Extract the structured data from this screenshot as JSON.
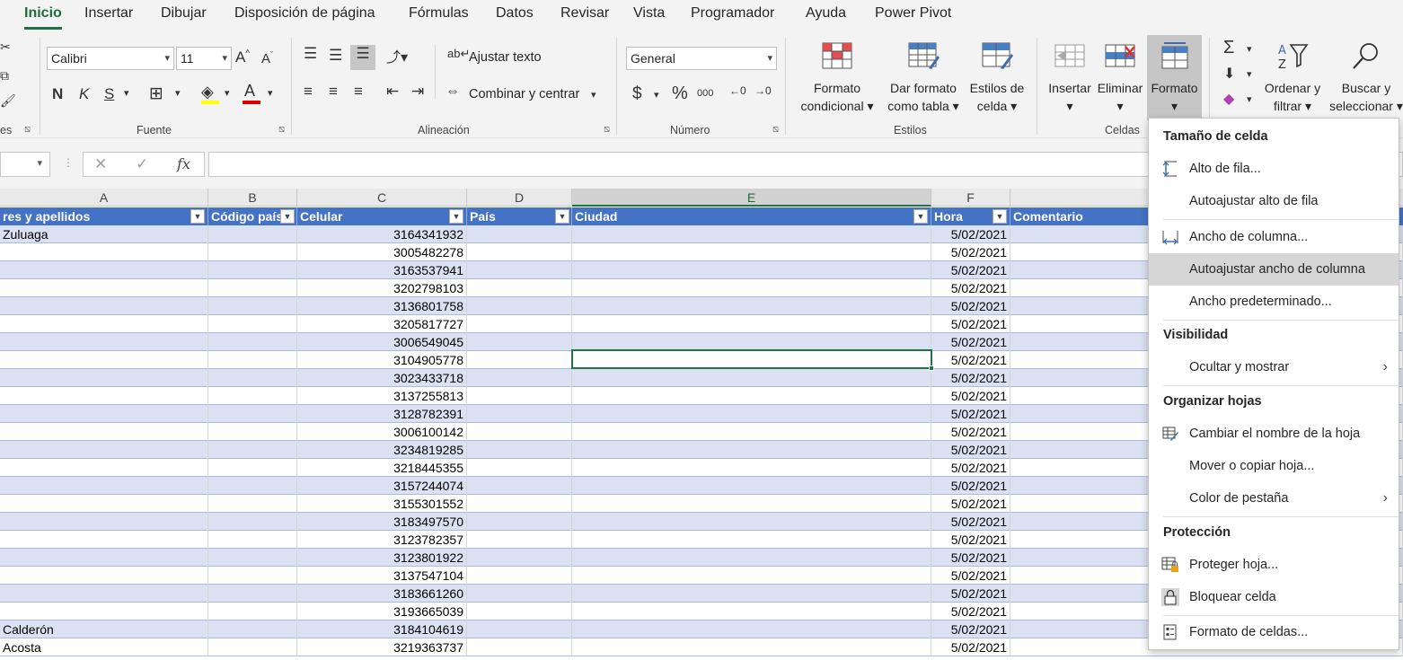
{
  "tabs": [
    "Inicio",
    "Insertar",
    "Dibujar",
    "Disposición de página",
    "Fórmulas",
    "Datos",
    "Revisar",
    "Vista",
    "Programador",
    "Ayuda",
    "Power Pivot"
  ],
  "ribbon": {
    "fuente": {
      "font_name": "Calibri",
      "font_size": "11",
      "bold": "N",
      "italic": "K",
      "underline": "S",
      "label": "Fuente",
      "fill_color": "#ffff00",
      "font_color": "#e00000"
    },
    "alineacion": {
      "wrap_text": "Ajustar texto",
      "merge_center": "Combinar y centrar",
      "label": "Alineación"
    },
    "numero": {
      "format": "General",
      "currency": "$",
      "percent": "%",
      "thousands": "000",
      "label": "Número"
    },
    "estilos": {
      "cond_format_1": "Formato",
      "cond_format_2": "condicional",
      "table_format_1": "Dar formato",
      "table_format_2": "como tabla",
      "cell_styles_1": "Estilos de",
      "cell_styles_2": "celda",
      "label": "Estilos"
    },
    "celdas": {
      "insert": "Insertar",
      "delete": "Eliminar",
      "format": "Formato",
      "label": "Celdas"
    },
    "edicion": {
      "sort_filter_1": "Ordenar y",
      "sort_filter_2": "filtrar",
      "find_select_1": "Buscar y",
      "find_select_2": "seleccionar"
    }
  },
  "formula_bar": {
    "cancel": "✕",
    "enter": "✓",
    "fx": "fx"
  },
  "columns": [
    "A",
    "B",
    "C",
    "D",
    "E",
    "F"
  ],
  "table_headers": [
    "res y apellidos",
    "Código país",
    "Celular",
    "País",
    "Ciudad",
    "Hora",
    "Comentario"
  ],
  "rows": [
    {
      "a": "Zuluaga",
      "c": "3164341932",
      "f": "5/02/2021"
    },
    {
      "a": "",
      "c": "3005482278",
      "f": "5/02/2021"
    },
    {
      "a": "",
      "c": "3163537941",
      "f": "5/02/2021"
    },
    {
      "a": "",
      "c": "3202798103",
      "f": "5/02/2021"
    },
    {
      "a": "",
      "c": "3136801758",
      "f": "5/02/2021"
    },
    {
      "a": "",
      "c": "3205817727",
      "f": "5/02/2021"
    },
    {
      "a": "",
      "c": "3006549045",
      "f": "5/02/2021"
    },
    {
      "a": "",
      "c": "3104905778",
      "f": "5/02/2021"
    },
    {
      "a": "",
      "c": "3023433718",
      "f": "5/02/2021"
    },
    {
      "a": "",
      "c": "3137255813",
      "f": "5/02/2021"
    },
    {
      "a": "",
      "c": "3128782391",
      "f": "5/02/2021"
    },
    {
      "a": "",
      "c": "3006100142",
      "f": "5/02/2021"
    },
    {
      "a": "",
      "c": "3234819285",
      "f": "5/02/2021"
    },
    {
      "a": "",
      "c": "3218445355",
      "f": "5/02/2021"
    },
    {
      "a": "",
      "c": "3157244074",
      "f": "5/02/2021"
    },
    {
      "a": "",
      "c": "3155301552",
      "f": "5/02/2021"
    },
    {
      "a": "",
      "c": "3183497570",
      "f": "5/02/2021"
    },
    {
      "a": "",
      "c": "3123782357",
      "f": "5/02/2021"
    },
    {
      "a": "",
      "c": "3123801922",
      "f": "5/02/2021"
    },
    {
      "a": "",
      "c": "3137547104",
      "f": "5/02/2021"
    },
    {
      "a": "",
      "c": "3183661260",
      "f": "5/02/2021"
    },
    {
      "a": "",
      "c": "3193665039",
      "f": "5/02/2021"
    },
    {
      "a": "Calderón",
      "c": "3184104619",
      "f": "5/02/2021"
    },
    {
      "a": "Acosta",
      "c": "3219363737",
      "f": "5/02/2021"
    }
  ],
  "menu": {
    "sections": [
      "Tamaño de celda",
      "Visibilidad",
      "Organizar hojas",
      "Protección"
    ],
    "items": [
      "Alto de fila...",
      "Autoajustar alto de fila",
      "Ancho de columna...",
      "Autoajustar ancho de columna",
      "Ancho predeterminado...",
      "Ocultar y mostrar",
      "Cambiar el nombre de la hoja",
      "Mover o copiar hoja...",
      "Color de pestaña",
      "Proteger hoja...",
      "Bloquear celda",
      "Formato de celdas..."
    ]
  },
  "colors": {
    "accent": "#217346",
    "table_header": "#4472c4",
    "band": "#d9e1f2"
  }
}
